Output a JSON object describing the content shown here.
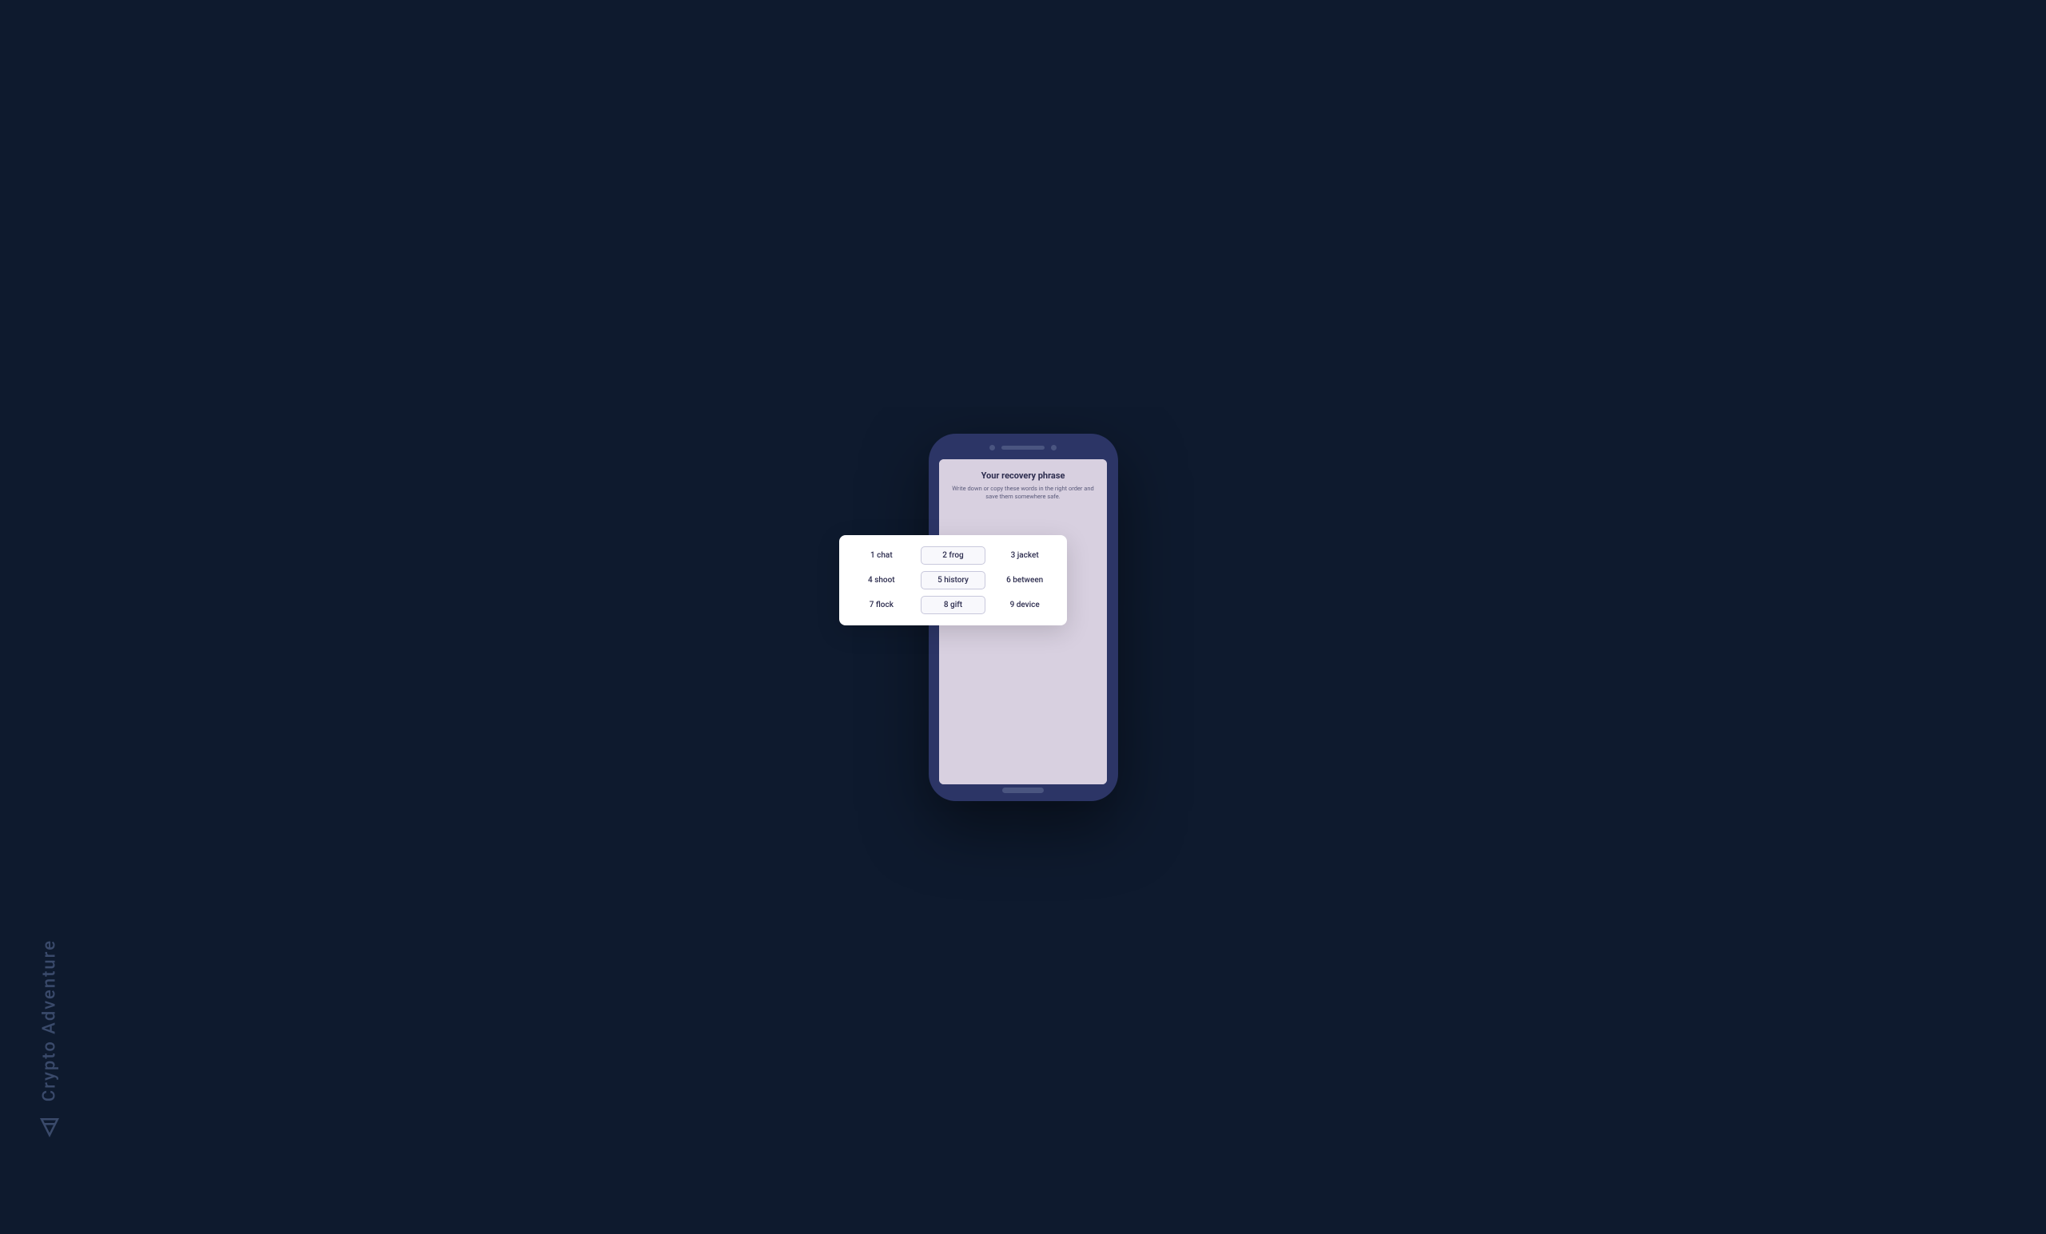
{
  "watermark": {
    "text": "Crypto Adventure",
    "icon_label": "crypto-adventure-icon"
  },
  "phone": {
    "screen": {
      "title": "Your recovery phrase",
      "subtitle": "Write down or copy these words in the right order and save them somewhere safe."
    },
    "recovery_phrase": {
      "words": [
        {
          "number": 1,
          "word": "chat"
        },
        {
          "number": 2,
          "word": "frog"
        },
        {
          "number": 3,
          "word": "jacket"
        },
        {
          "number": 4,
          "word": "shoot"
        },
        {
          "number": 5,
          "word": "history"
        },
        {
          "number": 6,
          "word": "between"
        },
        {
          "number": 7,
          "word": "flock"
        },
        {
          "number": 8,
          "word": "gift"
        },
        {
          "number": 9,
          "word": "device"
        }
      ]
    }
  }
}
